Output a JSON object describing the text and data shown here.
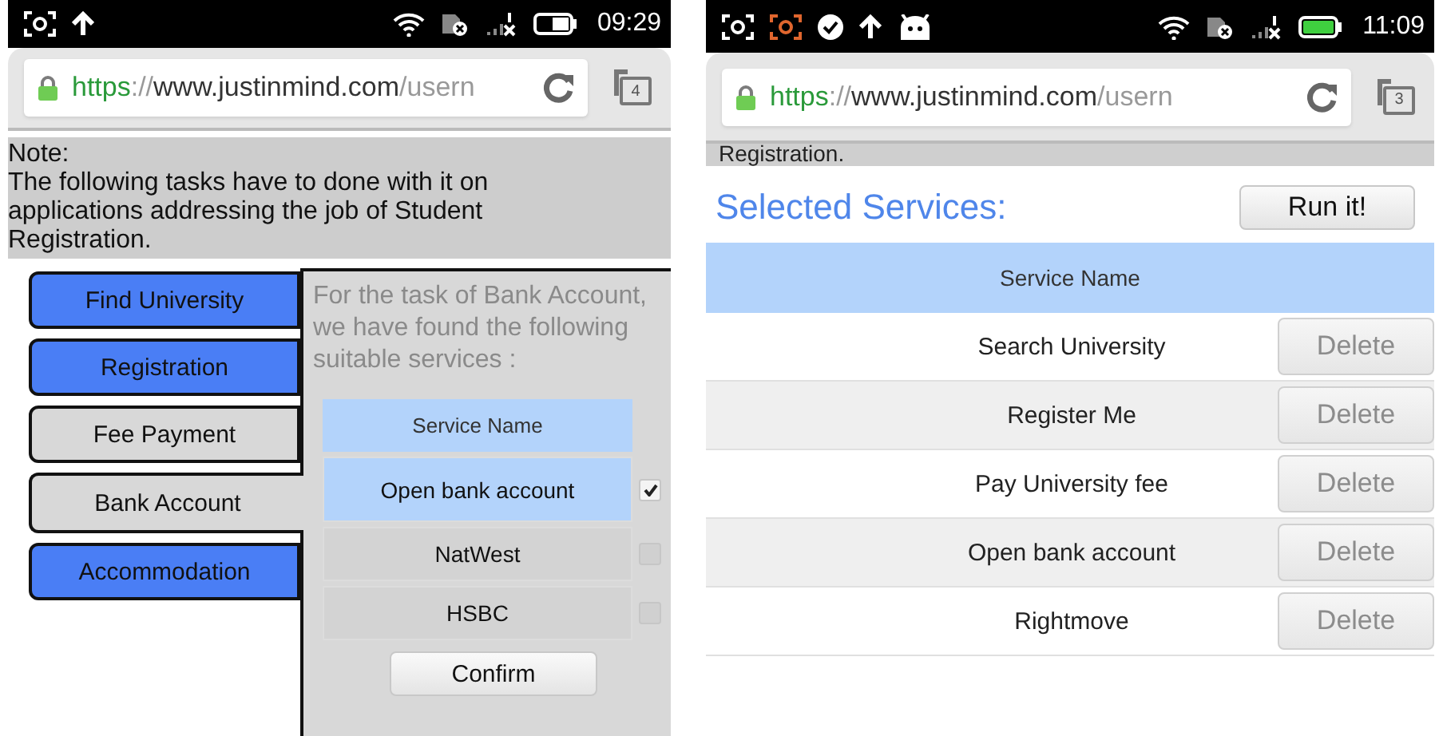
{
  "phones": [
    {
      "status_bar": {
        "time": "09:29"
      },
      "browser": {
        "url": {
          "scheme": "https",
          "separator": "://",
          "host": "www.justinmind.com",
          "path": "/usern"
        },
        "tab_count": "4"
      },
      "note": {
        "title": "Note:",
        "text": "The following tasks have to done with it on applications addressing the job of  Student Registration."
      },
      "tasks": [
        {
          "label": "Find University",
          "selected": false,
          "color": "#4a7ef5"
        },
        {
          "label": "Registration",
          "selected": false,
          "color": "#4a7ef5"
        },
        {
          "label": "Fee Payment",
          "selected": false,
          "color": "#d8d8d8"
        },
        {
          "label": "Bank Account",
          "selected": true,
          "color": "#d8d8d8"
        },
        {
          "label": "Accommodation",
          "selected": false,
          "color": "#4a7ef5"
        }
      ],
      "panel": {
        "description": "For the task of Bank Account, we have found the following suitable services :",
        "table": {
          "columns": [
            "Service Name"
          ],
          "rows": [
            {
              "name": "Open bank account",
              "selected": true,
              "checked": true
            },
            {
              "name": "NatWest",
              "selected": false,
              "checked": false
            },
            {
              "name": "HSBC",
              "selected": false,
              "checked": false
            }
          ]
        },
        "button": "Confirm"
      }
    },
    {
      "status_bar": {
        "time": "11:09"
      },
      "browser": {
        "url": {
          "scheme": "https",
          "separator": "://",
          "host": "www.justinmind.com",
          "path": "/usern"
        },
        "tab_count": "3"
      },
      "scrolled_text": "Registration.",
      "selected_services": {
        "title": "Selected Services:",
        "button": "Run it!",
        "table": {
          "columns": [
            "Service Name"
          ],
          "rows": [
            {
              "name": "Search University",
              "action": "Delete"
            },
            {
              "name": "Register Me",
              "action": "Delete"
            },
            {
              "name": "Pay University fee",
              "action": "Delete"
            },
            {
              "name": "Open bank account",
              "action": "Delete"
            },
            {
              "name": "Rightmove",
              "action": "Delete"
            }
          ]
        }
      }
    }
  ]
}
